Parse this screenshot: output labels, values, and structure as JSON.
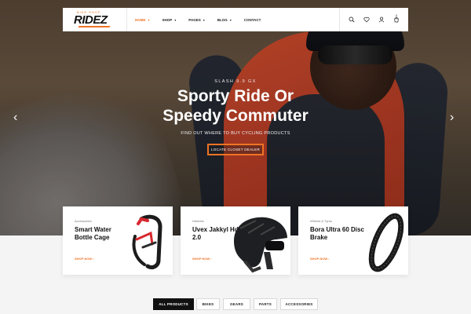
{
  "brand": {
    "logo_text": "RIDEZ",
    "tagline": "BIKE SHOP"
  },
  "nav": {
    "items": [
      {
        "label": "HOME",
        "caret": "▾",
        "active": true
      },
      {
        "label": "SHOP",
        "caret": "▾"
      },
      {
        "label": "PAGES",
        "caret": "▾"
      },
      {
        "label": "BLOG",
        "caret": "▾"
      },
      {
        "label": "CONTACT",
        "caret": ""
      }
    ]
  },
  "header_icons": [
    "search-icon",
    "heart-icon",
    "user-icon",
    "cart-icon"
  ],
  "cart_count": "0",
  "hero": {
    "subtitle": "SLASH 9.9 GX",
    "title_line1": "Sporty Ride Or",
    "title_line2": "Speedy Commuter",
    "description": "FIND OUT WHERE TO BUY CYCLING PRODUCTS",
    "cta": "LOCATE CLOSET DEALER",
    "prev_arrow": "‹",
    "next_arrow": "›"
  },
  "products": [
    {
      "category": "Accessories",
      "title": "Smart Water Bottle Cage",
      "link": "SHOP NOW ›"
    },
    {
      "category": "Helmets",
      "title": "Uvex Jakkyl Hde 2.0",
      "link": "SHOP NOW ›"
    },
    {
      "category": "Wheels & Tyres",
      "title": "Bora Ultra 60 Disc Brake",
      "link": "SHOP NOW ›"
    }
  ],
  "filters": [
    {
      "label": "ALL PRODUCTS",
      "active": true
    },
    {
      "label": "BIKES"
    },
    {
      "label": "GEARS"
    },
    {
      "label": "PARTS"
    },
    {
      "label": "ACCESSORIES"
    }
  ],
  "colors": {
    "accent": "#f07325",
    "dark": "#111111"
  }
}
